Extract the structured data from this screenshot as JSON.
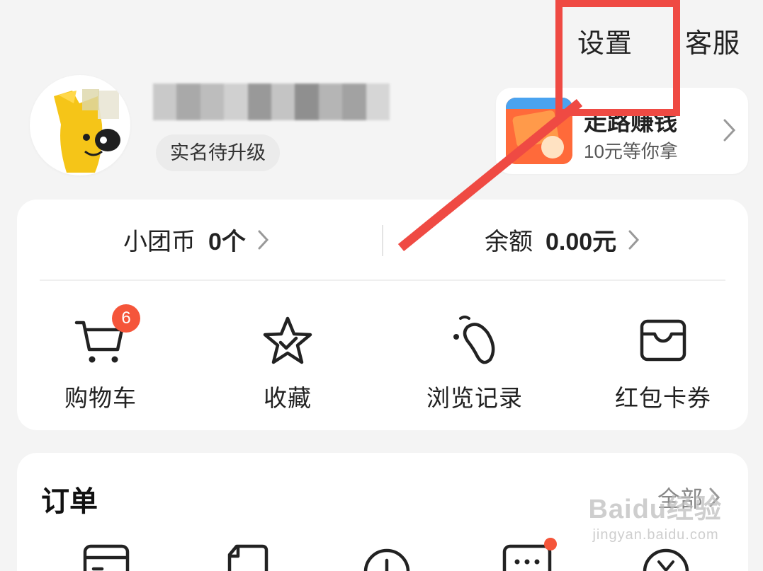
{
  "header": {
    "settings_label": "设置",
    "service_label": "客服"
  },
  "profile": {
    "avatar_icon": "mascot-avatar",
    "verify_badge": "实名待升级"
  },
  "promo": {
    "title": "走路赚钱",
    "subtitle": "10元等你拿"
  },
  "wallet": {
    "coins_label": "小团币",
    "coins_value": "0个",
    "balance_label": "余额",
    "balance_value": "0.00元"
  },
  "shortcuts": [
    {
      "label": "购物车",
      "icon": "cart-icon",
      "badge": "6"
    },
    {
      "label": "收藏",
      "icon": "star-icon"
    },
    {
      "label": "浏览记录",
      "icon": "footprint-icon"
    },
    {
      "label": "红包卡券",
      "icon": "wallet-icon"
    }
  ],
  "orders": {
    "title": "订单",
    "all_label": "全部"
  },
  "watermark": {
    "brand": "Baidu经验",
    "site": "jingyan.baidu.com"
  },
  "colors": {
    "accent_red": "#f5553a",
    "annotation_red": "#ef4a43",
    "background": "#f4f4f4"
  }
}
